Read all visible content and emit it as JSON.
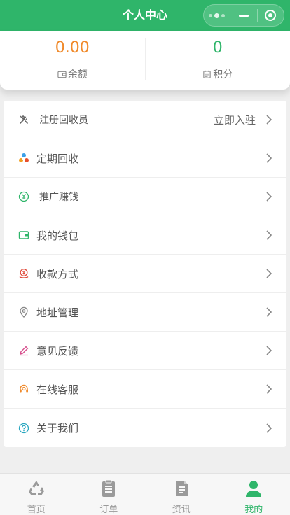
{
  "header": {
    "title": "个人中心"
  },
  "stats": {
    "balance": {
      "value": "0.00",
      "label": "余额",
      "icon": "wallet-icon"
    },
    "points": {
      "value": "0",
      "label": "积分",
      "icon": "points-icon"
    }
  },
  "menu": {
    "items": [
      {
        "label": "注册回收员",
        "extra": "立即入驻",
        "icon": "tools-icon"
      },
      {
        "label": "定期回收",
        "icon": "recycle-color-icon"
      },
      {
        "label": "推广赚钱",
        "icon": "yen-coin-icon"
      },
      {
        "label": "我的钱包",
        "icon": "wallet-icon"
      },
      {
        "label": "收款方式",
        "icon": "payment-icon"
      },
      {
        "label": "地址管理",
        "icon": "location-pin-icon"
      },
      {
        "label": "意见反馈",
        "icon": "pencil-icon"
      },
      {
        "label": "在线客服",
        "icon": "headset-icon"
      },
      {
        "label": "关于我们",
        "icon": "question-circle-icon"
      }
    ]
  },
  "tabbar": {
    "tabs": [
      {
        "label": "首页",
        "icon": "recycle-icon"
      },
      {
        "label": "订单",
        "icon": "clipboard-icon"
      },
      {
        "label": "资讯",
        "icon": "document-icon"
      },
      {
        "label": "我的",
        "icon": "user-icon",
        "active": true
      }
    ]
  },
  "colors": {
    "brand": "#2fb56a",
    "accent": "#f08a2b"
  }
}
